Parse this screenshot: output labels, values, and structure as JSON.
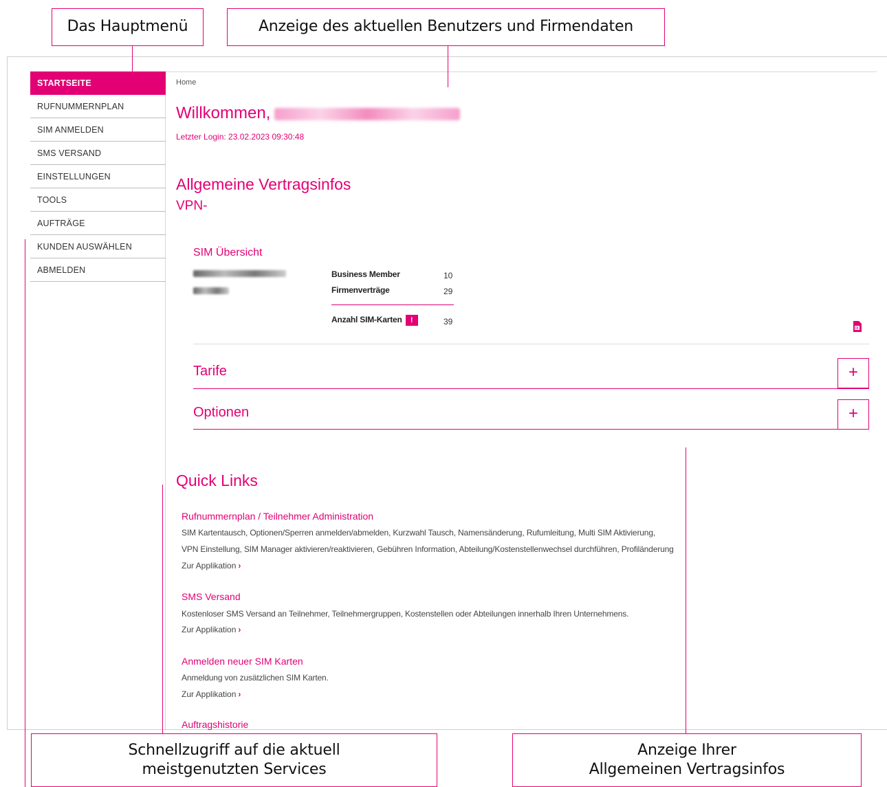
{
  "colors": {
    "accent": "#e20074"
  },
  "annotations": {
    "hauptmenu": "Das Hauptmenü",
    "benutzer": "Anzeige des aktuellen Benutzers und Firmendaten",
    "schnell_line1": "Schnellzugriff auf die aktuell",
    "schnell_line2": "meistgenutzten Services",
    "vertrag_line1": "Anzeige Ihrer",
    "vertrag_line2": "Allgemeinen Vertragsinfos"
  },
  "sidebar": {
    "items": [
      {
        "label": "STARTSEITE"
      },
      {
        "label": "RUFNUMMERNPLAN"
      },
      {
        "label": "SIM ANMELDEN"
      },
      {
        "label": "SMS VERSAND"
      },
      {
        "label": "EINSTELLUNGEN"
      },
      {
        "label": "TOOLS"
      },
      {
        "label": "AUFTRÄGE"
      },
      {
        "label": "KUNDEN AUSWÄHLEN"
      },
      {
        "label": "ABMELDEN"
      }
    ]
  },
  "main": {
    "breadcrumb": "Home",
    "welcome": "Willkommen,",
    "last_login": "Letzter Login: 23.02.2023 09:30:48",
    "vertragsinfos_title": "Allgemeine Vertragsinfos",
    "vpn_label": "VPN-",
    "sim_overview": {
      "title": "SIM Übersicht",
      "stats": [
        {
          "label": "Business Member",
          "value": "10"
        },
        {
          "label": "Firmenverträge",
          "value": "29"
        }
      ],
      "sim_count_label": "Anzahl SIM-Karten",
      "sim_count_badge": "!",
      "sim_count_value": "39"
    },
    "accordion": [
      {
        "label": "Tarife",
        "button": "+"
      },
      {
        "label": "Optionen",
        "button": "+"
      }
    ]
  },
  "quick_links": {
    "title": "Quick Links",
    "link_label": "Zur Applikation",
    "link_arrow": "›",
    "items": [
      {
        "title": "Rufnummernplan / Teilnehmer Administration",
        "desc1": "SIM Kartentausch, Optionen/Sperren anmelden/abmelden, Kurzwahl Tausch, Namensänderung, Rufumleitung, Multi SIM Aktivierung,",
        "desc2": "VPN Einstellung, SIM Manager aktivieren/reaktivieren, Gebühren Information, Abteilung/Kostenstellenwechsel durchführen, Profiländerung"
      },
      {
        "title": "SMS Versand",
        "desc1": "Kostenloser SMS Versand an Teilnehmer, Teilnehmergruppen, Kostenstellen oder Abteilungen innerhalb Ihren Unternehmens."
      },
      {
        "title": "Anmelden neuer SIM Karten",
        "desc1": "Anmeldung von zusätzlichen SIM Karten."
      },
      {
        "title": "Auftragshistorie"
      }
    ]
  }
}
